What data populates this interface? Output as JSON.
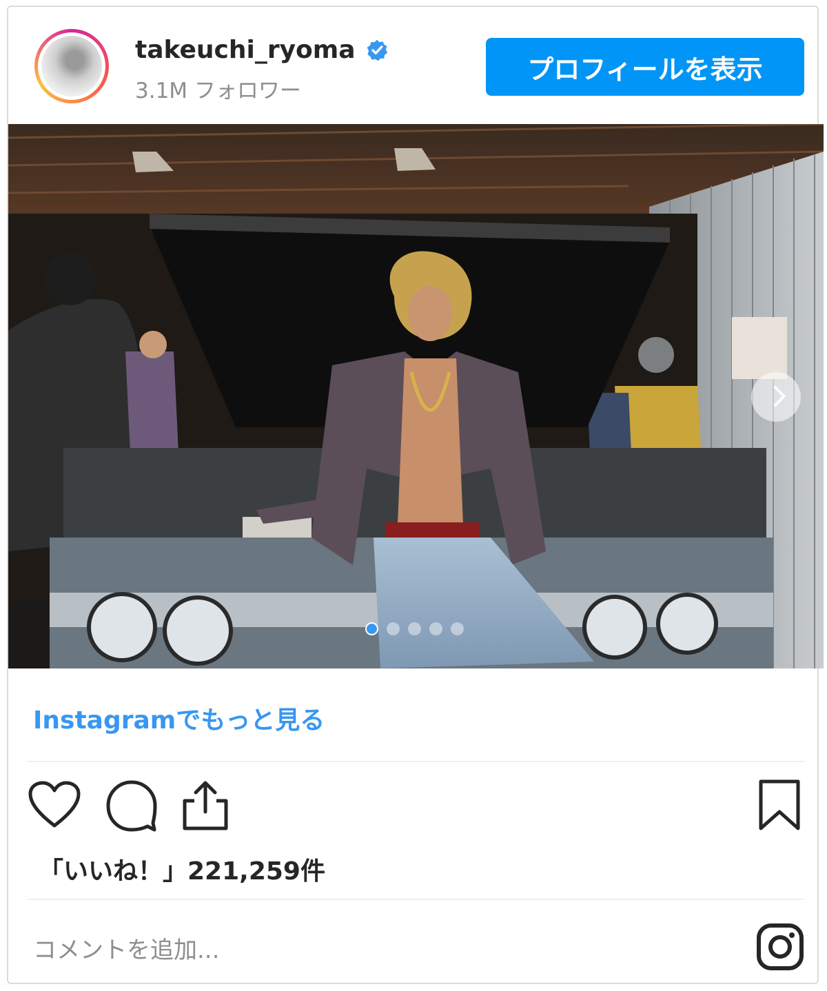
{
  "header": {
    "username": "takeuchi_ryoma",
    "followers": "3.1M フォロワー",
    "profile_button": "プロフィールを表示"
  },
  "media": {
    "carousel_count": 5,
    "carousel_active_index": 0
  },
  "links": {
    "more_on_instagram": "Instagramでもっと見る"
  },
  "stats": {
    "likes": "「いいね！」221,259件"
  },
  "comment": {
    "placeholder": "コメントを追加..."
  },
  "colors": {
    "accent": "#0095f6",
    "link": "#3897f0",
    "muted": "#8e8e8e"
  }
}
